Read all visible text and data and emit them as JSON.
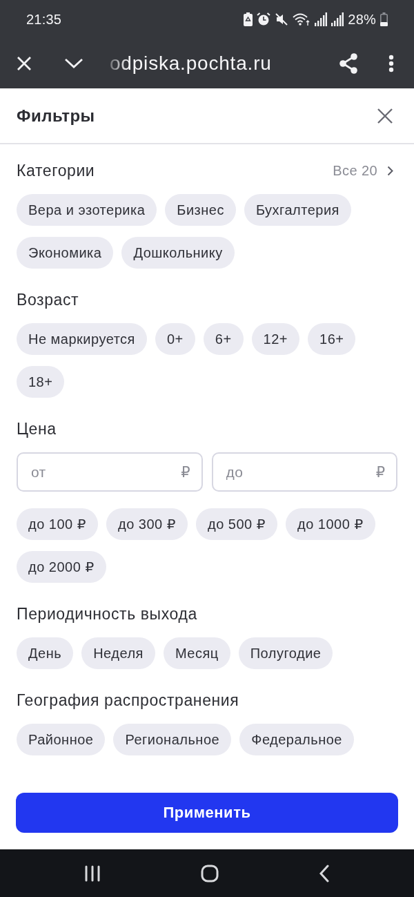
{
  "status_bar": {
    "time": "21:35",
    "battery": "28%"
  },
  "browser_bar": {
    "url": "odpiska.pochta.ru"
  },
  "sheet": {
    "title": "Фильтры"
  },
  "sections": [
    {
      "kind": "chips",
      "title": "Категории",
      "link": "Все 20",
      "chips": [
        {
          "label": "Вера и эзотерика",
          "selected": false
        },
        {
          "label": "Бизнес",
          "selected": false
        },
        {
          "label": "Бухгалтерия",
          "selected": false
        },
        {
          "label": "Экономика",
          "selected": false
        },
        {
          "label": "Дошкольнику",
          "selected": false
        }
      ]
    },
    {
      "kind": "chips",
      "title": "Возраст",
      "chips": [
        {
          "label": "Не маркируется",
          "selected": false
        },
        {
          "label": "0+",
          "selected": false
        },
        {
          "label": "6+",
          "selected": false
        },
        {
          "label": "12+",
          "selected": false
        },
        {
          "label": "16+",
          "selected": false
        },
        {
          "label": "18+",
          "selected": false
        }
      ]
    },
    {
      "kind": "price",
      "title": "Цена",
      "inputs": [
        {
          "placeholder": "от",
          "currency": "₽"
        },
        {
          "placeholder": "до",
          "currency": "₽"
        }
      ],
      "chips": [
        {
          "label": "до 100 ₽",
          "selected": false
        },
        {
          "label": "до 300 ₽",
          "selected": false
        },
        {
          "label": "до 500 ₽",
          "selected": false
        },
        {
          "label": "до 1000 ₽",
          "selected": false
        },
        {
          "label": "до 2000 ₽",
          "selected": false
        }
      ]
    },
    {
      "kind": "chips",
      "title": "Периодичность выхода",
      "chips": [
        {
          "label": "День",
          "selected": false
        },
        {
          "label": "Неделя",
          "selected": false
        },
        {
          "label": "Месяц",
          "selected": false
        },
        {
          "label": "Полугодие",
          "selected": false
        }
      ]
    },
    {
      "kind": "chips",
      "title": "География распространения",
      "chips": [
        {
          "label": "Районное",
          "selected": false
        },
        {
          "label": "Региональное",
          "selected": false
        },
        {
          "label": "Федеральное",
          "selected": false
        }
      ]
    }
  ],
  "apply_button": {
    "label": "Применить"
  }
}
